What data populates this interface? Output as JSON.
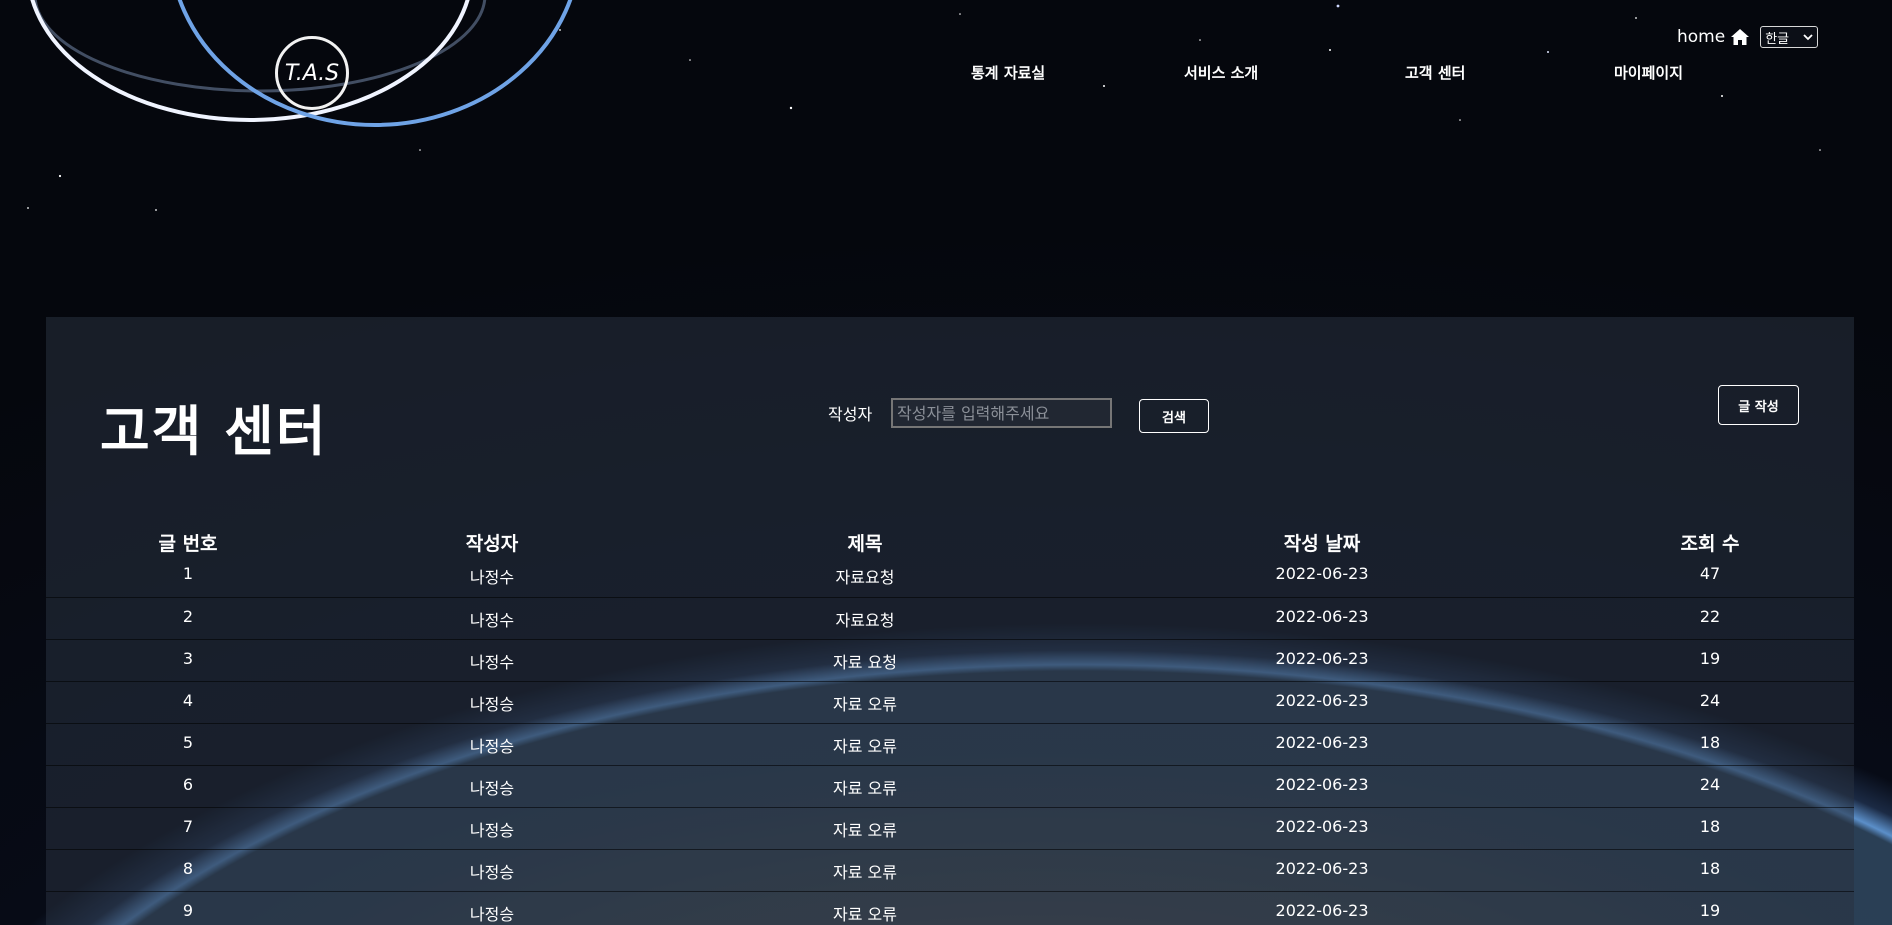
{
  "header": {
    "logo_text": "T.A.S",
    "nav": [
      {
        "label": "통계 자료실"
      },
      {
        "label": "서비스 소개"
      },
      {
        "label": "고객 센터"
      },
      {
        "label": "마이페이지"
      }
    ],
    "home_label": "home",
    "language": "한글"
  },
  "main": {
    "title": "고객 센터",
    "search": {
      "label": "작성자",
      "placeholder": "작성자를 입력해주세요",
      "value": "",
      "button_label": "검색"
    },
    "write_button_label": "글 작성"
  },
  "table": {
    "columns": [
      "글 번호",
      "작성자",
      "제목",
      "작성 날짜",
      "조회 수"
    ],
    "rows": [
      [
        "1",
        "나정수",
        "자료요청",
        "2022-06-23",
        "47"
      ],
      [
        "2",
        "나정수",
        "자료요청",
        "2022-06-23",
        "22"
      ],
      [
        "3",
        "나정수",
        "자료 요청",
        "2022-06-23",
        "19"
      ],
      [
        "4",
        "나정승",
        "자료 오류",
        "2022-06-23",
        "24"
      ],
      [
        "5",
        "나정승",
        "자료 오류",
        "2022-06-23",
        "18"
      ],
      [
        "6",
        "나정승",
        "자료 오류",
        "2022-06-23",
        "24"
      ],
      [
        "7",
        "나정승",
        "자료 오류",
        "2022-06-23",
        "18"
      ],
      [
        "8",
        "나정승",
        "자료 오류",
        "2022-06-23",
        "18"
      ],
      [
        "9",
        "나정승",
        "자료 오류",
        "2022-06-23",
        "19"
      ]
    ]
  },
  "colors": {
    "panel": "#283240",
    "accent_ring": "#6fa3e6",
    "text": "#ffffff"
  }
}
